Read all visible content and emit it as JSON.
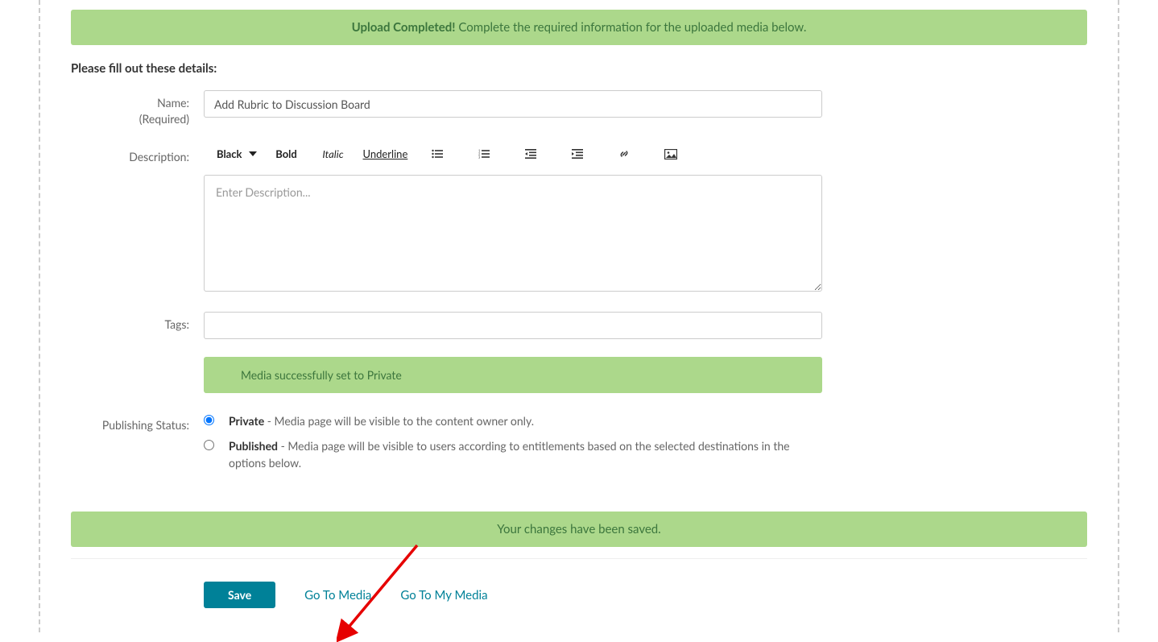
{
  "alert": {
    "bold_text": "Upload Completed!",
    "regular_text": "Complete the required information for the uploaded media below."
  },
  "section_title": "Please fill out these details:",
  "form": {
    "name_label": "Name:",
    "name_required": "(Required)",
    "name_value": "Add Rubric to Discussion Board",
    "description_label": "Description:",
    "description_placeholder": "Enter Description...",
    "tags_label": "Tags:",
    "publishing_label": "Publishing Status:"
  },
  "toolbar": {
    "color": "Black",
    "bold": "Bold",
    "italic": "Italic",
    "underline": "Underline"
  },
  "status_banner": "Media successfully set to Private",
  "publishing": {
    "private_label": "Private",
    "private_desc": " - Media page will be visible to the content owner only.",
    "published_label": "Published",
    "published_desc": " - Media page will be visible to users according to entitlements based on the selected destinations in the options below."
  },
  "saved_banner": "Your changes have been saved.",
  "actions": {
    "save": "Save",
    "go_to_media": "Go To Media",
    "go_to_my_media": "Go To My Media"
  }
}
